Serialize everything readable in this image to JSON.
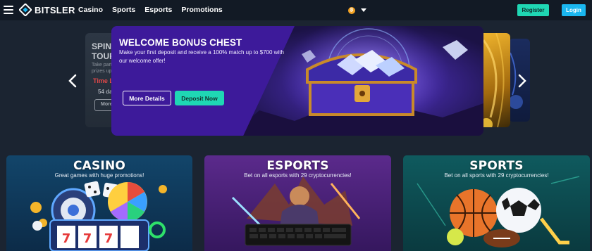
{
  "header": {
    "brand": "BITSLER",
    "nav": [
      "Casino",
      "Sports",
      "Esports",
      "Promotions"
    ],
    "currency_symbol": "₿",
    "register_label": "Register",
    "login_label": "Login"
  },
  "carousel": {
    "hero": {
      "title": "WELCOME BONUS CHEST",
      "subtitle": "Make your first deposit and receive a 100% match up to $700 with our welcome offer!",
      "more_label": "More Details",
      "deposit_label": "Deposit Now"
    },
    "left_card": {
      "title_line1": "SPIN",
      "title_line2": "TOUR",
      "text_line1": "Take part",
      "text_line2": "prizes up",
      "time_label": "Time L",
      "days_label": "54 da",
      "button_label": "More"
    }
  },
  "categories": [
    {
      "title": "CASINO",
      "subtitle": "Great games with huge promotions!"
    },
    {
      "title": "ESPORTS",
      "subtitle": "Bet on all esports with 29 cryptocurrencies!"
    },
    {
      "title": "SPORTS",
      "subtitle": "Bet on all sports with 29 cryptocurrencies!"
    }
  ],
  "colors": {
    "accent_teal": "#1fd7b4",
    "accent_blue": "#1ab7f0",
    "hero_purple": "#3d1a9a",
    "time_red": "#e04848"
  }
}
